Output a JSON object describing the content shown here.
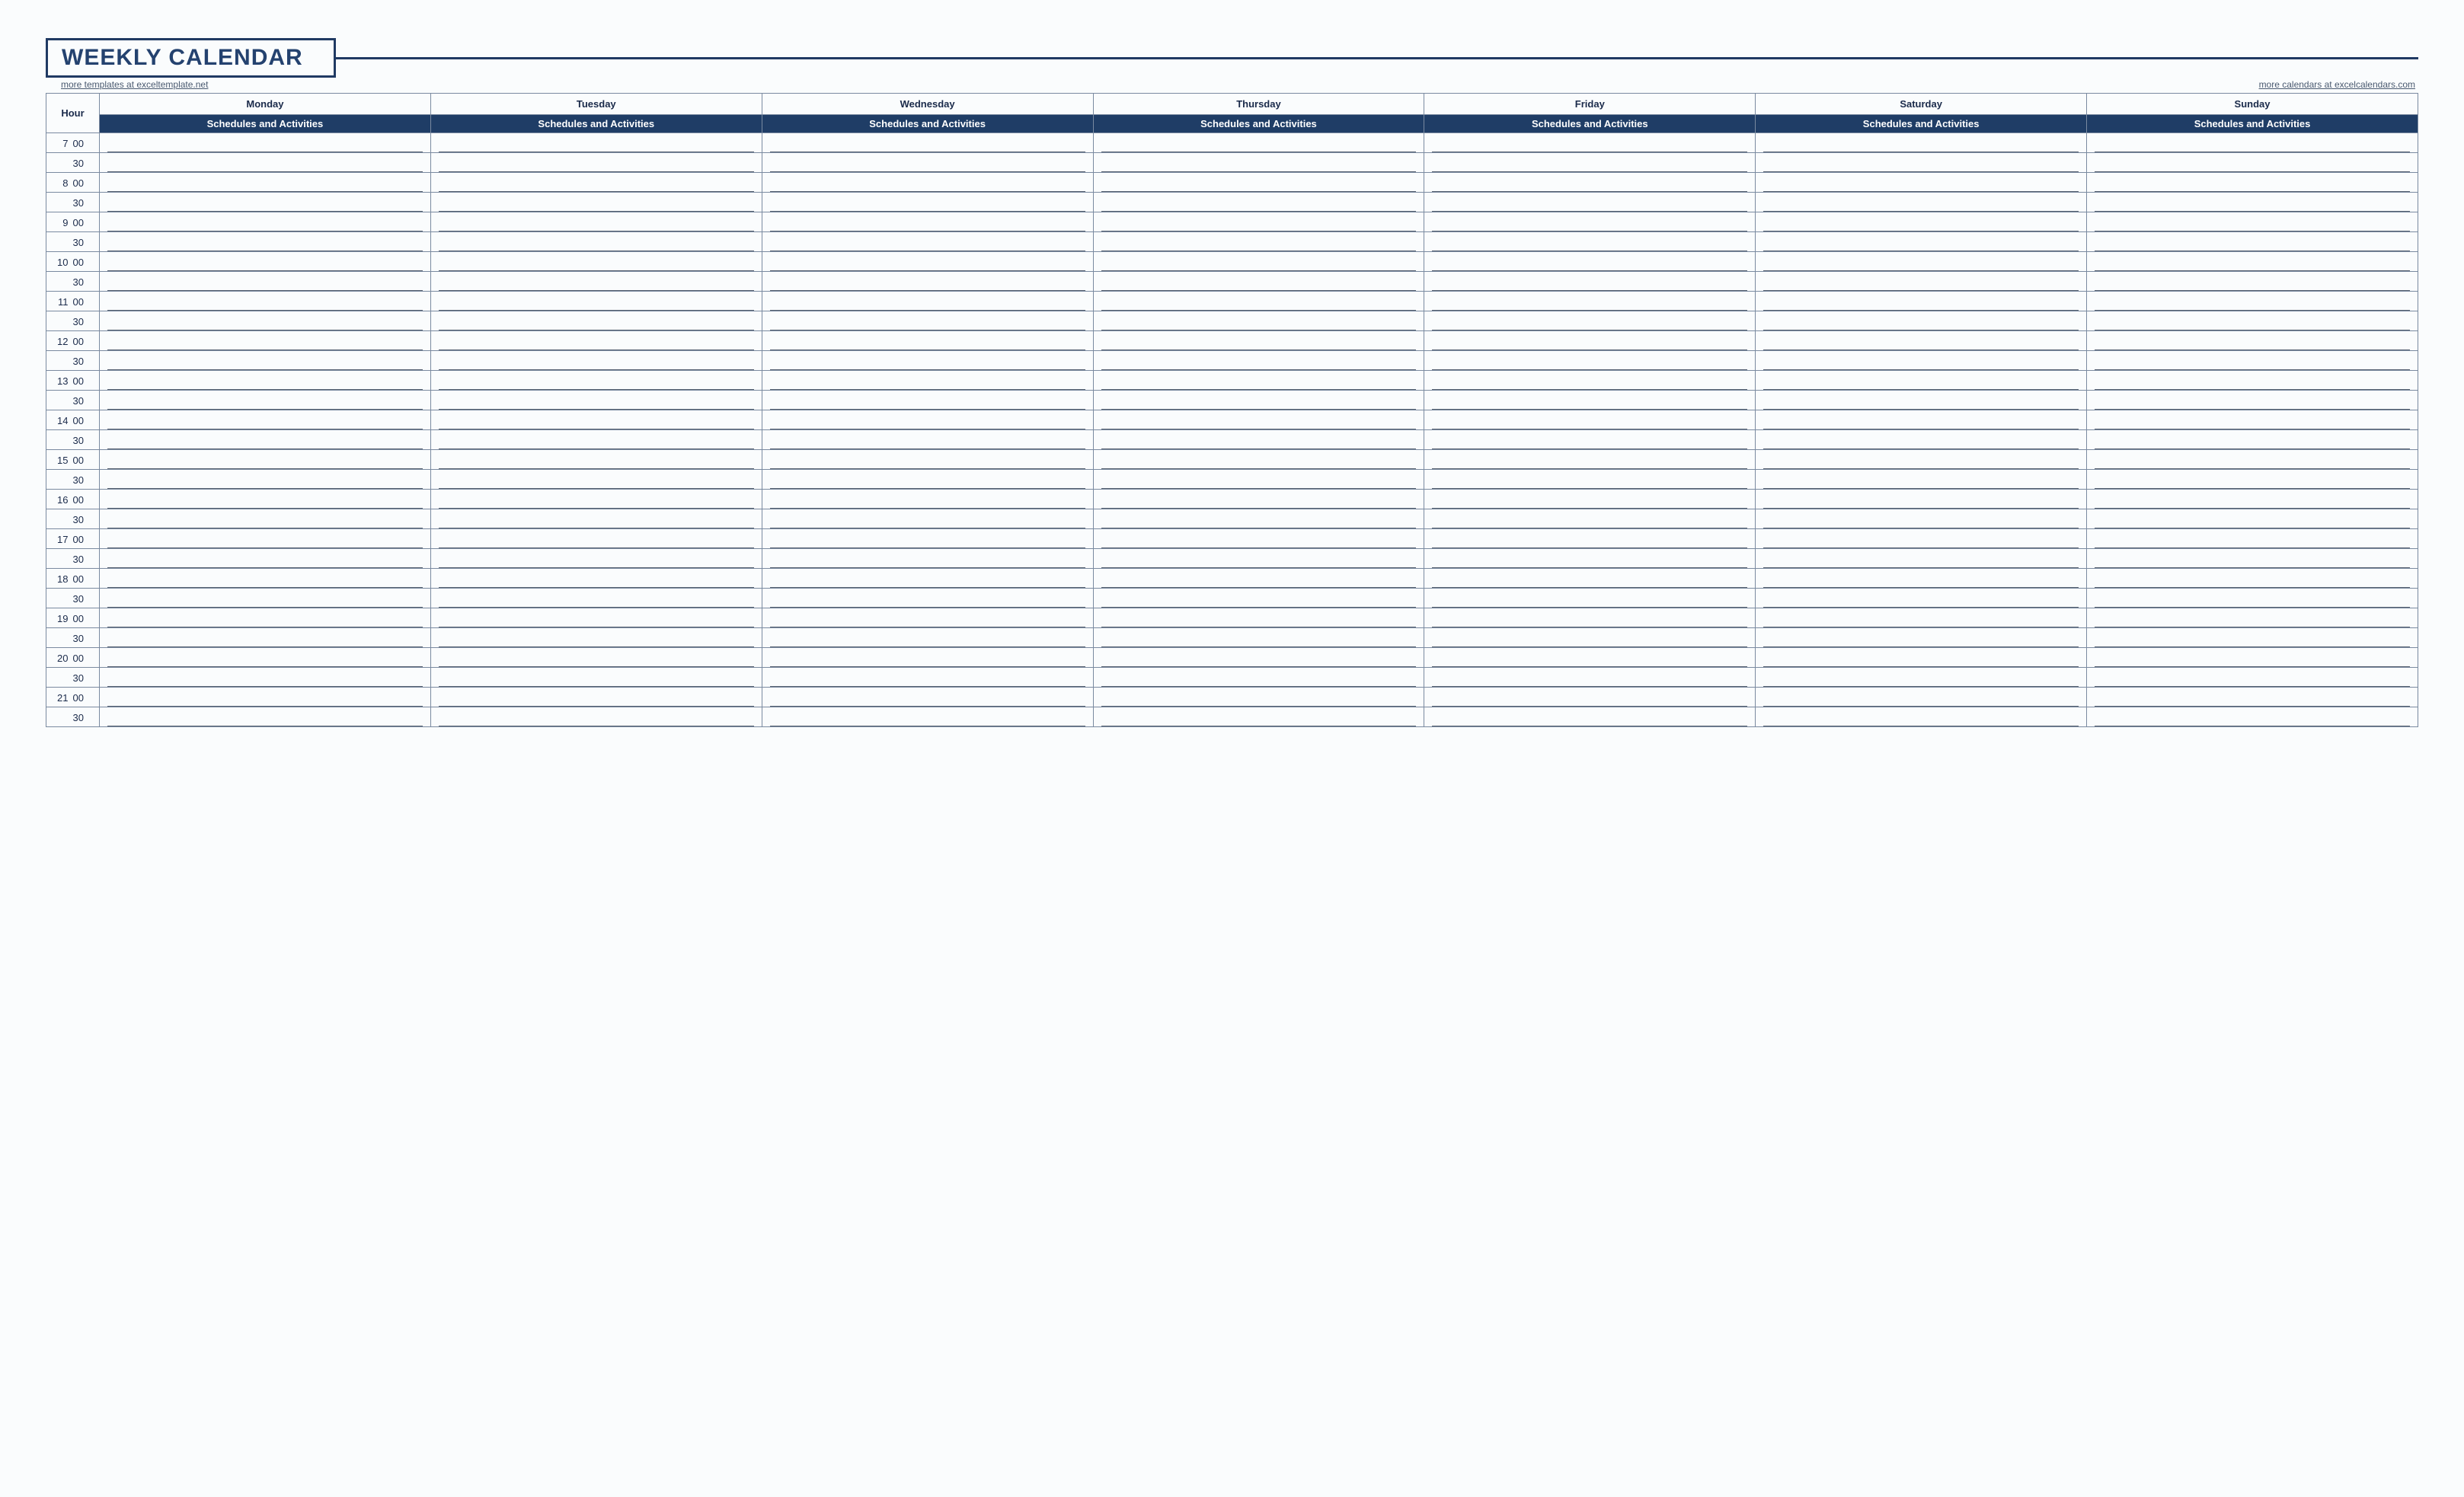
{
  "title": "WEEKLY CALENDAR",
  "link_left": "more templates at exceltemplate.net",
  "link_right": "more calendars at excelcalendars.com",
  "hour_header": "Hour",
  "subheader": "Schedules and Activities",
  "days": [
    "Monday",
    "Tuesday",
    "Wednesday",
    "Thursday",
    "Friday",
    "Saturday",
    "Sunday"
  ],
  "hours": [
    7,
    8,
    9,
    10,
    11,
    12,
    13,
    14,
    15,
    16,
    17,
    18,
    19,
    20,
    21
  ],
  "minutes_top": "00",
  "minutes_bottom": "30",
  "colors": {
    "accent": "#1f3d66",
    "border": "#7a8aa0",
    "text": "#1a2a4a",
    "bg": "#fafcfd"
  }
}
